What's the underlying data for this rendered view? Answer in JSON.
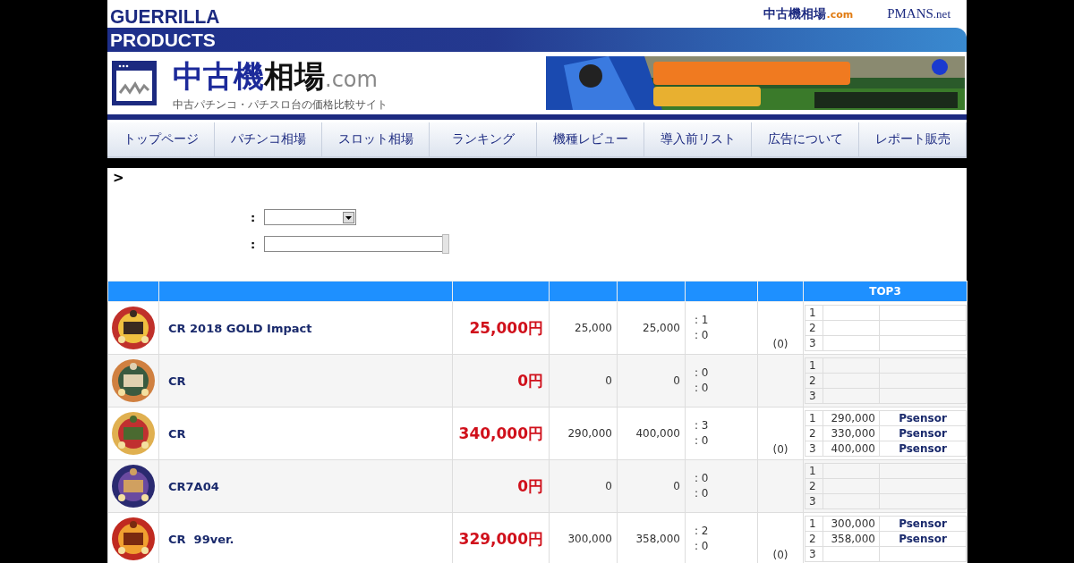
{
  "header": {
    "brand_top": "GUERRILLA",
    "brand_bottom": "PRODUCTS",
    "top_links": [
      {
        "label": "中古機相場",
        "suffix": ".com",
        "kind": "site"
      },
      {
        "label": "PMANS",
        "suffix": ".net",
        "kind": "pmans"
      }
    ],
    "logo": {
      "main_blue": "中古機",
      "main_black": "相場",
      "suffix": ".com",
      "tagline": "中古パチンコ・パチスロ台の価格比較サイト"
    }
  },
  "nav": [
    "トップページ",
    "パチンコ相場",
    "スロット相場",
    "ランキング",
    "機種レビュー",
    "導入前リスト",
    "広告について",
    "レポート販売"
  ],
  "breadcrumb": ">",
  "form": [
    {
      "label": ":",
      "kind": "select"
    },
    {
      "label": ":",
      "kind": "text"
    }
  ],
  "table": {
    "top3_heading": "TOP3",
    "rows": [
      {
        "name": "CR 2018 GOLD Impact",
        "price": "25,000円",
        "column_4": "25,000",
        "column_5": "25,000",
        "stats": [
          ": 1",
          ": 0"
        ],
        "reviews": "(0)",
        "top3": [
          {
            "rank": "1"
          },
          {
            "rank": "2"
          },
          {
            "rank": "3"
          }
        ]
      },
      {
        "name": "CR",
        "price": "0円",
        "column_4": "0",
        "column_5": "0",
        "stats": [
          ": 0",
          ": 0"
        ],
        "top3": [
          {
            "rank": "1"
          },
          {
            "rank": "2"
          },
          {
            "rank": "3"
          }
        ]
      },
      {
        "name": "CR",
        "price": "340,000円",
        "column_4": "290,000",
        "column_5": "400,000",
        "stats": [
          ": 3",
          ": 0"
        ],
        "reviews": "(0)",
        "top3": [
          {
            "rank": "1",
            "price": "290,000",
            "shop": "Psensor"
          },
          {
            "rank": "2",
            "price": "330,000",
            "shop": "Psensor"
          },
          {
            "rank": "3",
            "price": "400,000",
            "shop": "Psensor"
          }
        ]
      },
      {
        "name": "CR7A04",
        "price": "0円",
        "column_4": "0",
        "column_5": "0",
        "stats": [
          ": 0",
          ": 0"
        ],
        "top3": [
          {
            "rank": "1"
          },
          {
            "rank": "2"
          },
          {
            "rank": "3"
          }
        ]
      },
      {
        "name": "CR  99ver.",
        "price": "329,000円",
        "column_4": "300,000",
        "column_5": "358,000",
        "stats": [
          ": 2",
          ": 0"
        ],
        "reviews": "(0)",
        "top3": [
          {
            "rank": "1",
            "price": "300,000",
            "shop": "Psensor"
          },
          {
            "rank": "2",
            "price": "358,000",
            "shop": "Psensor"
          },
          {
            "rank": "3"
          }
        ]
      }
    ]
  }
}
